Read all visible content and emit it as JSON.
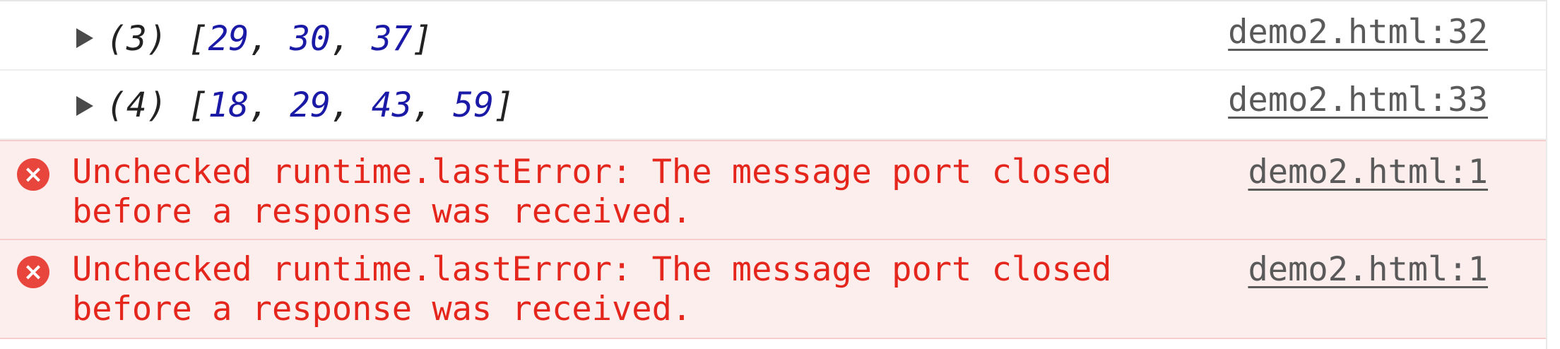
{
  "console": {
    "rows": [
      {
        "type": "log",
        "count": "(3)",
        "values": [
          "29",
          "30",
          "37"
        ],
        "source": "demo2.html:32"
      },
      {
        "type": "log",
        "count": "(4)",
        "values": [
          "18",
          "29",
          "43",
          "59"
        ],
        "source": "demo2.html:33"
      },
      {
        "type": "error",
        "icon": "error-icon",
        "line1": "Unchecked runtime.lastError: The message port closed",
        "line2": "before a response was received.",
        "source": "demo2.html:1"
      },
      {
        "type": "error",
        "icon": "error-icon",
        "line1": "Unchecked runtime.lastError: The message port closed",
        "line2": "before a response was received.",
        "source": "demo2.html:1"
      }
    ]
  },
  "colors": {
    "error_text": "#e4261c",
    "error_background": "#fdeeee",
    "array_number": "#1a1aa6",
    "source_link": "#5a5a5a"
  }
}
